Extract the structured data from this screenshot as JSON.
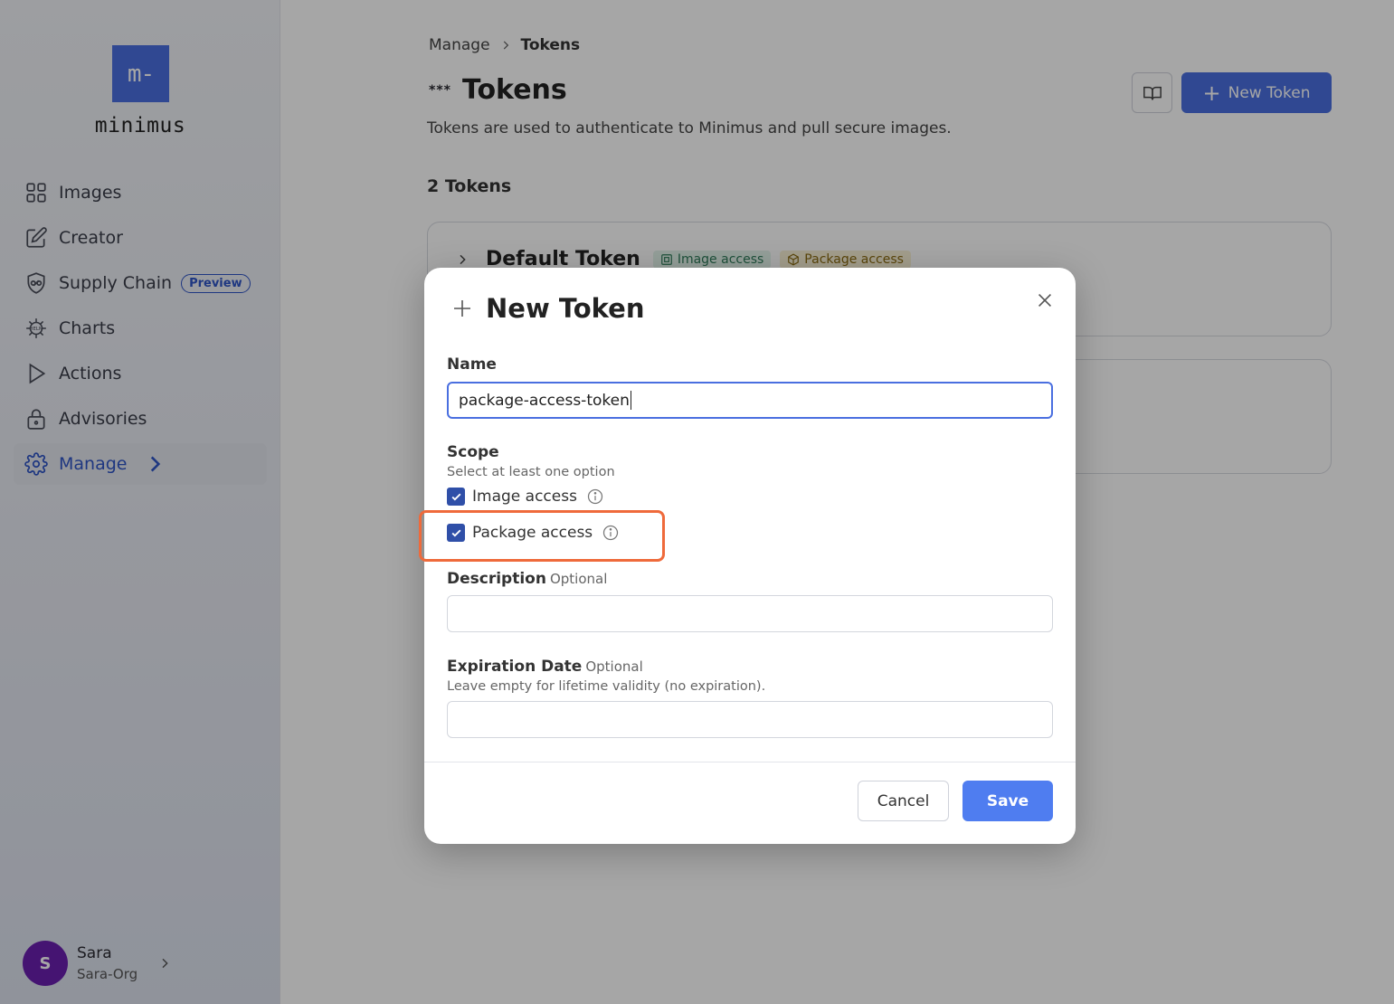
{
  "sidebar": {
    "logo_text": "m-",
    "brand": "minimus",
    "items": [
      {
        "label": "Images",
        "icon": "grid-icon"
      },
      {
        "label": "Creator",
        "icon": "edit-icon"
      },
      {
        "label": "Supply Chain",
        "icon": "shield-link-icon",
        "badge": "Preview"
      },
      {
        "label": "Charts",
        "icon": "helm-icon"
      },
      {
        "label": "Actions",
        "icon": "play-icon"
      },
      {
        "label": "Advisories",
        "icon": "lock-icon"
      },
      {
        "label": "Manage",
        "icon": "gear-icon",
        "active": true
      }
    ],
    "user": {
      "initial": "S",
      "name": "Sara",
      "org": "Sara-Org"
    }
  },
  "breadcrumb": {
    "parent": "Manage",
    "current": "Tokens"
  },
  "page": {
    "title_prefix": "***",
    "title": "Tokens",
    "subtitle": "Tokens are used to authenticate to Minimus and pull secure images.",
    "new_button": "New Token",
    "count": "2 Tokens"
  },
  "tokens": [
    {
      "name": "Default Token",
      "tags": [
        "Image access",
        "Package access"
      ]
    }
  ],
  "modal": {
    "title": "New Token",
    "name_label": "Name",
    "name_value": "package-access-token",
    "scope_label": "Scope",
    "scope_hint": "Select at least one option",
    "options": [
      {
        "label": "Image access",
        "checked": true
      },
      {
        "label": "Package access",
        "checked": true
      }
    ],
    "description_label": "Description",
    "description_optional": "Optional",
    "description_value": "",
    "expiration_label": "Expiration Date",
    "expiration_optional": "Optional",
    "expiration_hint": "Leave empty for lifetime validity (no expiration).",
    "expiration_value": "",
    "cancel": "Cancel",
    "save": "Save"
  },
  "colors": {
    "accent": "#4a6fe0",
    "highlight": "#ef6a3b",
    "checkbox": "#2f4fa8"
  }
}
